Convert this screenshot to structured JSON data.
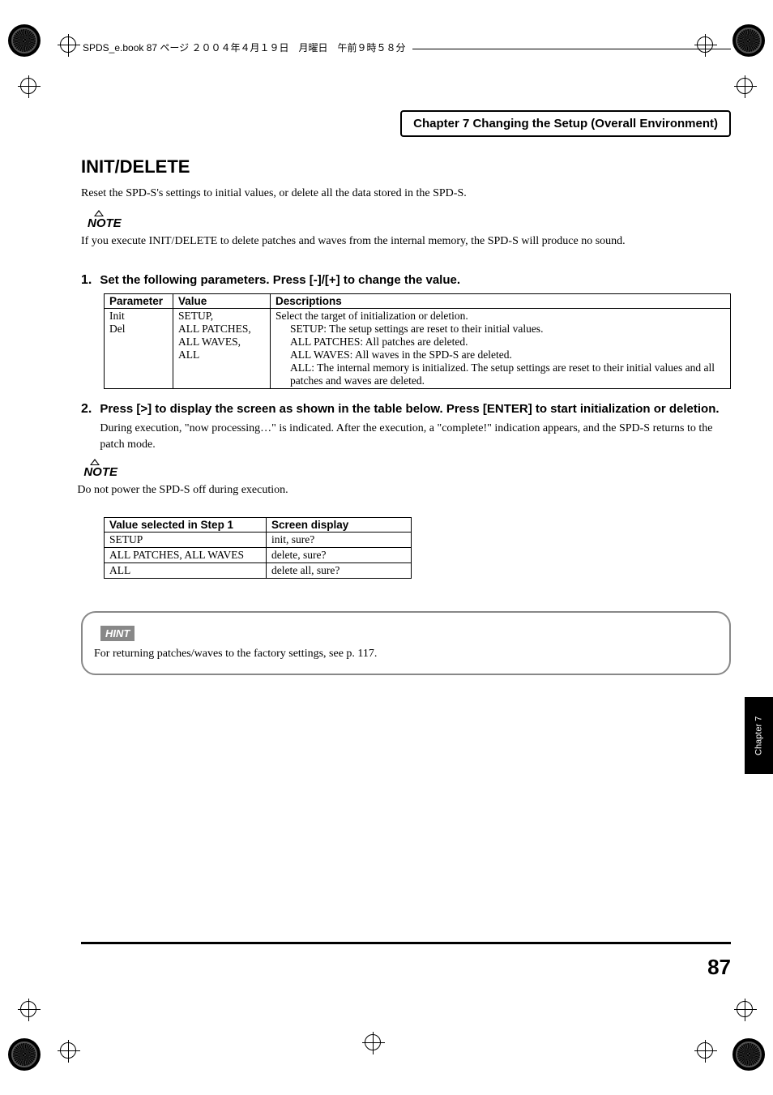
{
  "header_text": "SPDS_e.book  87 ページ  ２００４年４月１９日　月曜日　午前９時５８分",
  "chapter_header": "Chapter 7 Changing the Setup (Overall Environment)",
  "section_title": "INIT/DELETE",
  "intro_text": "Reset the SPD-S's settings to initial values, or delete all the data stored in the SPD-S.",
  "note_label": "NOTE",
  "note1_text": "If you execute INIT/DELETE to delete patches and waves from the internal memory, the SPD-S will produce no sound.",
  "step1_num": "1.",
  "step1_heading": "Set the following parameters. Press [-]/[+] to change the value.",
  "table1": {
    "headers": {
      "c1": "Parameter",
      "c2": "Value",
      "c3": "Descriptions"
    },
    "row1": {
      "param": "Init Del",
      "value": "SETUP, ALL PATCHES, ALL WAVES, ALL",
      "desc_main": "Select the target of initialization or deletion.",
      "desc_l1": "SETUP: The setup settings are reset to their initial values.",
      "desc_l2": "ALL PATCHES: All patches are deleted.",
      "desc_l3": "ALL WAVES: All waves in the SPD-S are deleted.",
      "desc_l4": "ALL: The internal memory is initialized. The setup settings are reset to their initial values and all patches and waves are deleted."
    }
  },
  "step2_num": "2.",
  "step2_heading": "Press [>] to display the screen as shown in the table below. Press [ENTER] to start initialization or deletion.",
  "step2_text": "During execution, \"now processing…\" is indicated. After the execution, a \"complete!\" indication appears, and the SPD-S returns to the patch mode.",
  "note2_text": "Do not power the SPD-S off during execution.",
  "table2": {
    "headers": {
      "c1": "Value selected in Step 1",
      "c2": "Screen display"
    },
    "rows": [
      {
        "c1": "SETUP",
        "c2": "init, sure?"
      },
      {
        "c1": "ALL PATCHES, ALL WAVES",
        "c2": "delete, sure?"
      },
      {
        "c1": "ALL",
        "c2": "delete all, sure?"
      }
    ]
  },
  "hint_label": "HINT",
  "hint_text": "For returning patches/waves to the factory settings, see p. 117.",
  "chapter_tab": "Chapter 7",
  "page_num": "87"
}
